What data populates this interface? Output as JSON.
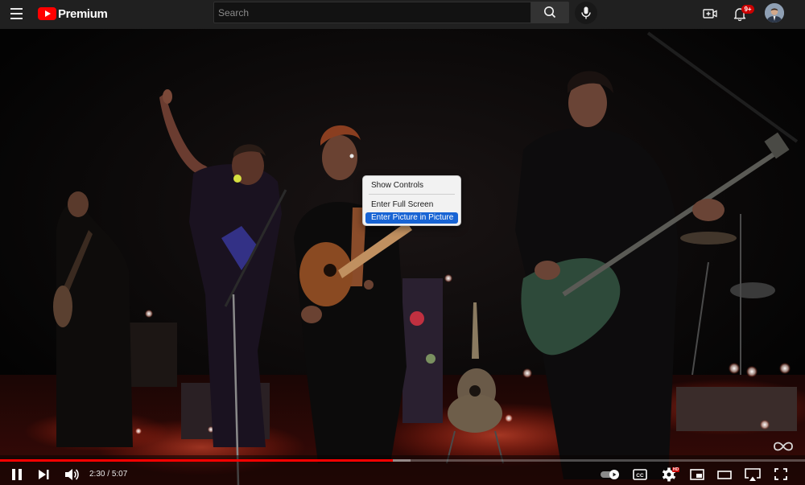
{
  "header": {
    "logo_text": "Premium",
    "search_placeholder": "Search",
    "notification_count": "9+"
  },
  "context_menu": {
    "items": [
      {
        "label": "Show Controls",
        "highlighted": false
      },
      {
        "label": "Enter Full Screen",
        "highlighted": false
      },
      {
        "label": "Enter Picture in Picture",
        "highlighted": true
      }
    ]
  },
  "player": {
    "current_time": "2:30",
    "separator": " / ",
    "duration": "5:07",
    "played_fraction": 0.488,
    "buffered_fraction": 0.51,
    "quality_badge": "HD",
    "autoplay": true
  },
  "colors": {
    "brand_red": "#ff0000",
    "menu_highlight": "#1864d4",
    "topbar": "#202020"
  },
  "icons": [
    "menu-icon",
    "youtube-logo-icon",
    "search-icon",
    "microphone-icon",
    "create-video-icon",
    "bell-icon",
    "pause-icon",
    "next-icon",
    "volume-icon",
    "autoplay-toggle-icon",
    "captions-icon",
    "settings-icon",
    "miniplayer-icon",
    "theater-mode-icon",
    "airplay-icon",
    "fullscreen-icon",
    "infinity-icon"
  ]
}
